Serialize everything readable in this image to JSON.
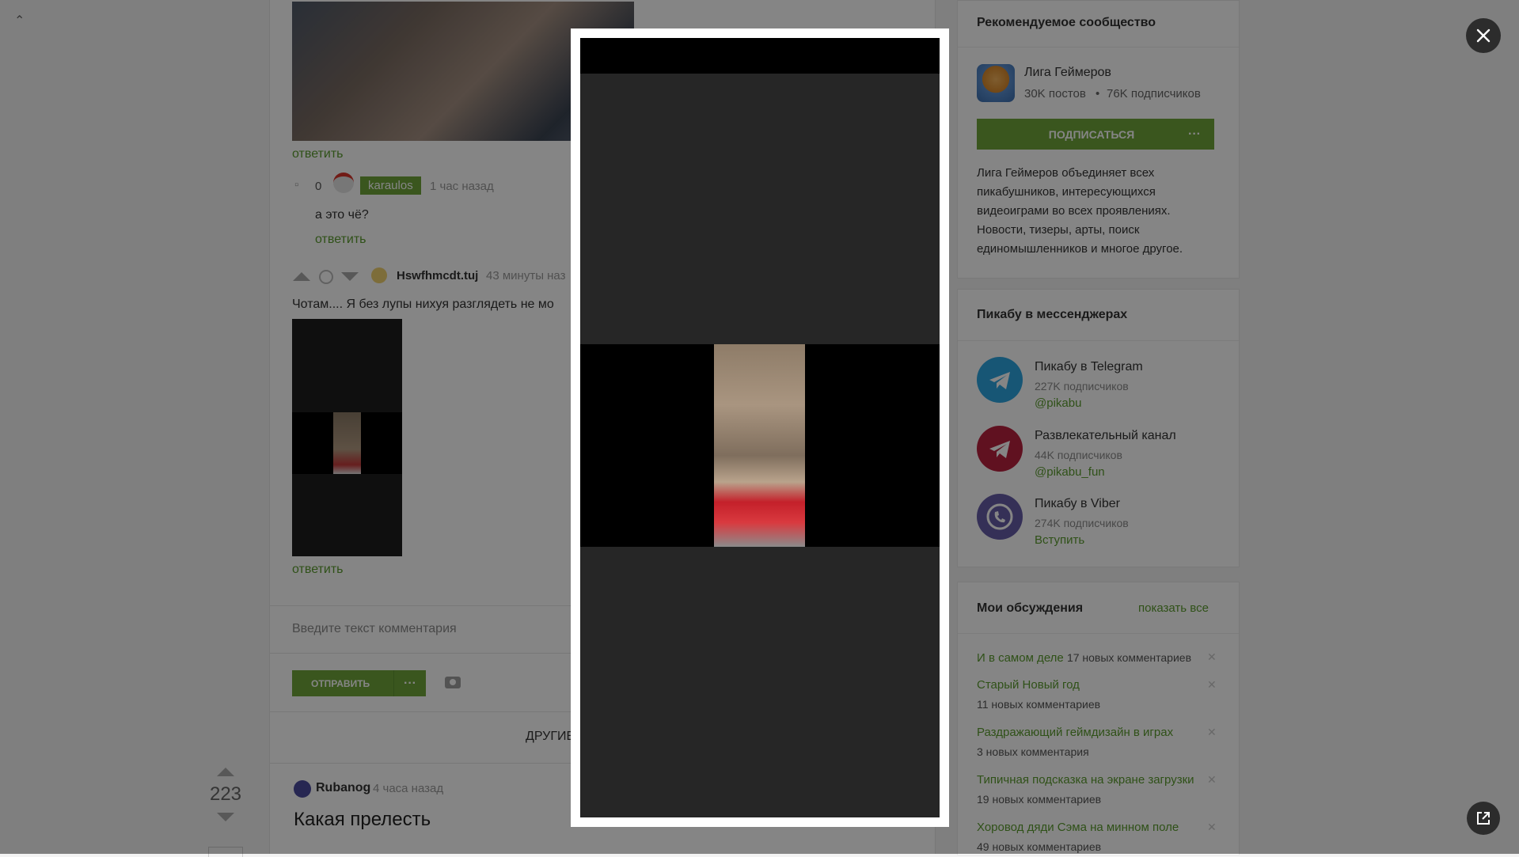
{
  "comments": {
    "reply_label": "ответить",
    "karaulos": {
      "score": "0",
      "user": "karaulos",
      "time": "1 час назад",
      "text": "а это чё?"
    },
    "hsw": {
      "user": "Hswfhmcdt.tuj",
      "time": "43 минуты наз",
      "text": "Чотам.... Я без лупы нихуя разглядеть не мо"
    }
  },
  "comment_form": {
    "placeholder": "Введите текст комментария",
    "send_label": "ОТПРАВИТЬ",
    "dots": "···"
  },
  "other_posts_label": "ДРУГИЕ",
  "next_post": {
    "score": "223",
    "author": "Rubanog",
    "time": "4 часа назад",
    "title": "Какая прелесть"
  },
  "sidebar": {
    "recommended": {
      "title": "Рекомендуемое сообщество",
      "name": "Лига Геймеров",
      "posts": "30K постов",
      "sep": "•",
      "subscribers": "76K подписчиков",
      "subscribe_label": "ПОДПИСАТЬСЯ",
      "dots": "···",
      "description": "Лига Геймеров объединяет всех пикабушников, интересующихся видеоиграми во всех проявлениях. Новости, тизеры, арты, поиск единомышленников и многое другое."
    },
    "messengers": {
      "title": "Пикабу в мессенджерах",
      "items": [
        {
          "title": "Пикабу в Telegram",
          "sub": "227K подписчиков",
          "link": "@pikabu",
          "color": "#2ca5e0"
        },
        {
          "title": "Развлекательный канал",
          "sub": "44K подписчиков",
          "link": "@pikabu_fun",
          "color": "#b8213f"
        },
        {
          "title": "Пикабу в Viber",
          "sub": "274K подписчиков",
          "link": "Вступить",
          "color": "#665ca7"
        }
      ]
    },
    "discussions": {
      "title": "Мои обсуждения",
      "show_all": "показать все",
      "items": [
        {
          "title": "И в самом деле",
          "count": "17 новых комментариев"
        },
        {
          "title": "Старый Новый год",
          "count": "11 новых комментариев"
        },
        {
          "title": "Раздражающий геймдизайн в играх",
          "count": "3 новых комментария"
        },
        {
          "title": "Типичная подсказка на экране загрузки",
          "count": "19 новых комментариев"
        },
        {
          "title": "Хоровод дяди Сэма на минном поле",
          "count": "49 новых комментариев"
        }
      ]
    }
  },
  "viewer": {
    "close_icon": "close-icon",
    "external_icon": "external-link-icon"
  },
  "colors": {
    "accent": "#6fa63b",
    "link": "#5b9b2e",
    "overlay": "rgba(0,0,0,0.48)"
  }
}
